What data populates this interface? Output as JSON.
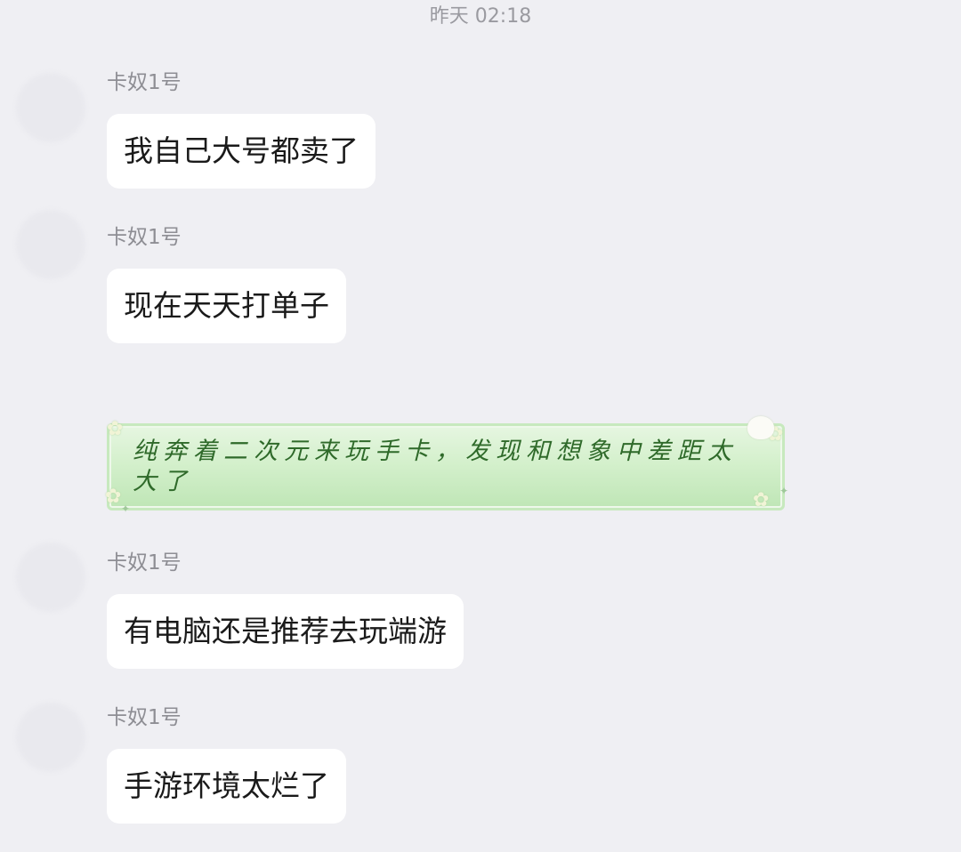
{
  "chat": {
    "timestamp": "昨天 02:18",
    "messages": [
      {
        "sender": "卡奴1号",
        "text": "我自己大号都卖了"
      },
      {
        "sender": "卡奴1号",
        "text": "现在天天打单子"
      },
      {
        "sender": "",
        "text": "纯奔着二次元来玩手卡，发现和想象中差距太大了"
      },
      {
        "sender": "卡奴1号",
        "text": "有电脑还是推荐去玩端游"
      },
      {
        "sender": "卡奴1号",
        "text": "手游环境太烂了"
      }
    ]
  },
  "colors": {
    "background": "#efeff3",
    "bubble": "#ffffff",
    "sender_text": "#8e8e94",
    "my_bubble_green": "#d4f0cc",
    "my_text": "#2f6a2a"
  }
}
